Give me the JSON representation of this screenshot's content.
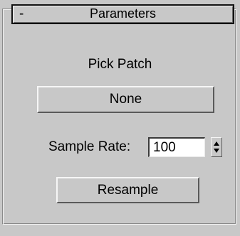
{
  "rollout": {
    "collapse_sign": "-",
    "title": "Parameters"
  },
  "pick": {
    "label": "Pick Patch",
    "button_label": "None"
  },
  "sample_rate": {
    "label": "Sample Rate:",
    "value": "100"
  },
  "resample": {
    "button_label": "Resample"
  },
  "icons": {
    "spinner": "spinner-arrows-icon"
  }
}
